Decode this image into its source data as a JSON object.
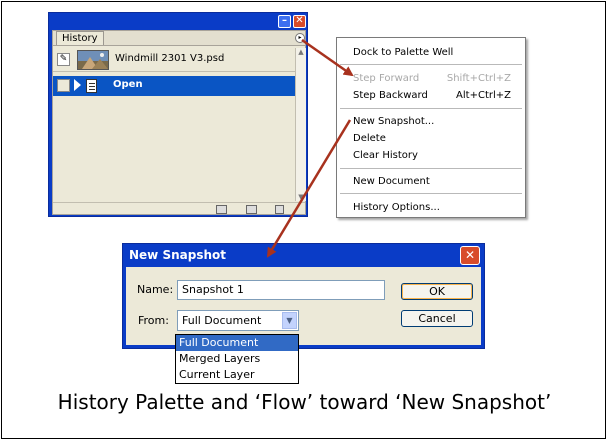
{
  "palette": {
    "tab_label": "History",
    "snapshot_name": "Windmill 2301 V3.psd",
    "state_name": "Open",
    "minimize_glyph": "–",
    "close_glyph": "✕",
    "menu_button_glyph": "▸",
    "icons": [
      "new-document-from-state-icon",
      "new-snapshot-icon",
      "delete-state-icon"
    ]
  },
  "menu": {
    "items": [
      {
        "label": "Dock to Palette Well",
        "shortcut": "",
        "disabled": false
      },
      {
        "label": "Step Forward",
        "shortcut": "Shift+Ctrl+Z",
        "disabled": true
      },
      {
        "label": "Step Backward",
        "shortcut": "Alt+Ctrl+Z",
        "disabled": false
      },
      {
        "label": "New Snapshot...",
        "shortcut": "",
        "disabled": false
      },
      {
        "label": "Delete",
        "shortcut": "",
        "disabled": false
      },
      {
        "label": "Clear History",
        "shortcut": "",
        "disabled": false
      },
      {
        "label": "New Document",
        "shortcut": "",
        "disabled": false
      },
      {
        "label": "History Options...",
        "shortcut": "",
        "disabled": false
      }
    ]
  },
  "dialog": {
    "title": "New Snapshot",
    "close_glyph": "✕",
    "name_label": "Name:",
    "name_value": "Snapshot 1",
    "from_label": "From:",
    "from_value": "Full Document",
    "ok_label": "OK",
    "cancel_label": "Cancel",
    "from_options": [
      "Full Document",
      "Merged Layers",
      "Current Layer"
    ],
    "selected_option": "Full Document"
  },
  "caption": "History Palette and ‘Flow’ toward ‘New Snapshot’",
  "colors": {
    "title_bar_blue": "#0a3cc7",
    "selection_blue": "#0a55c4",
    "arrow_red": "#a8321e",
    "dialog_face": "#ece9d8"
  }
}
